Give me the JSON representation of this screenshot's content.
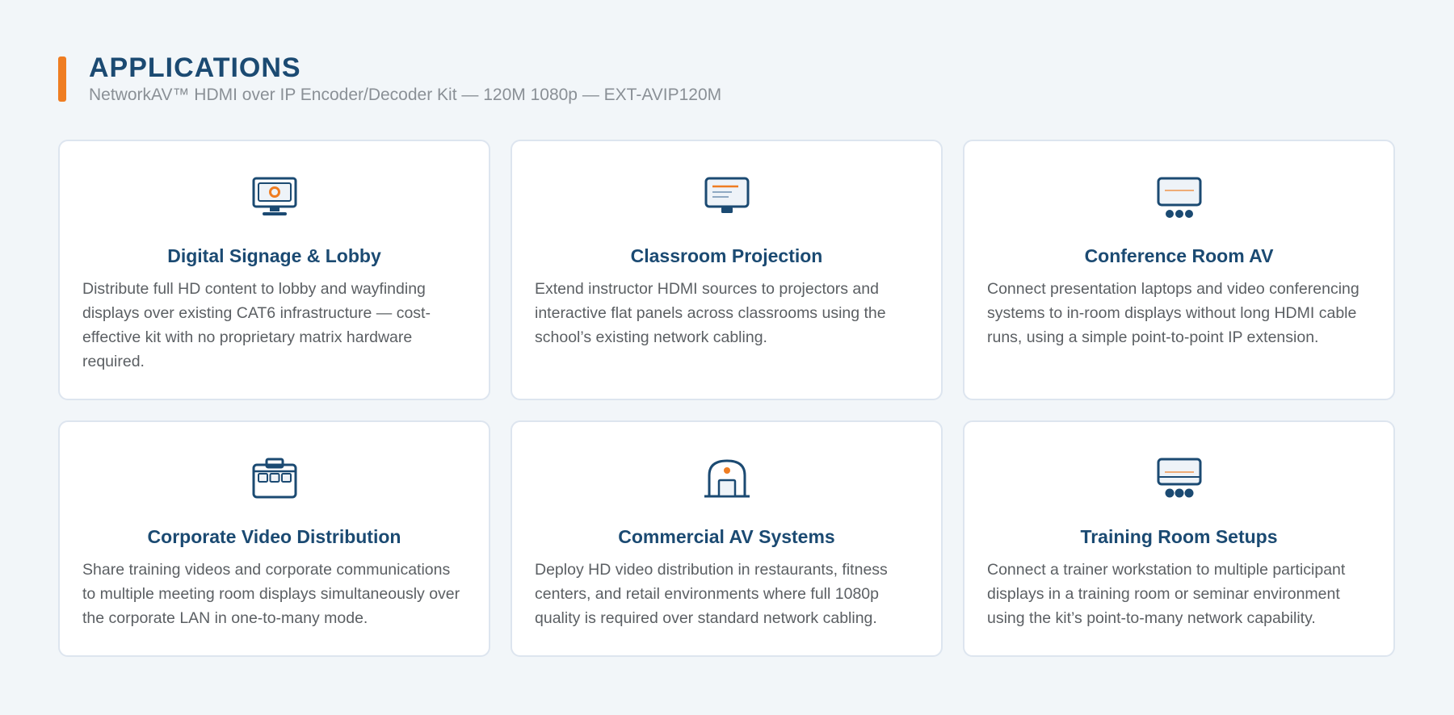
{
  "header": {
    "title": "APPLICATIONS",
    "subtitle": "NetworkAV™ HDMI over IP Encoder/Decoder Kit — 120M 1080p — EXT-AVIP120M"
  },
  "colors": {
    "accent": "#ef7d22",
    "primary": "#1b4a72",
    "background": "#f2f6f9",
    "card_border": "#dde5ef",
    "body_text": "#5b5f63",
    "subtitle_text": "#8a9096"
  },
  "cards": [
    {
      "icon": "monitor-icon",
      "title": "Digital Signage & Lobby",
      "description": "Distribute full HD content to lobby and wayfinding displays over existing CAT6 infrastructure — cost-effective kit with no proprietary matrix hardware required."
    },
    {
      "icon": "projector-screen-icon",
      "title": "Classroom Projection",
      "description": "Extend instructor HDMI sources to projectors and interactive flat panels across classrooms using the school’s existing network cabling."
    },
    {
      "icon": "conference-display-icon",
      "title": "Conference Room AV",
      "description": "Connect presentation laptops and video conferencing systems to in-room displays without long HDMI cable runs, using a simple point-to-point IP extension."
    },
    {
      "icon": "briefcase-icon",
      "title": "Corporate Video Distribution",
      "description": "Share training videos and corporate communications to multiple meeting room displays simultaneously over the corporate LAN in one-to-many mode."
    },
    {
      "icon": "storefront-icon",
      "title": "Commercial AV Systems",
      "description": "Deploy HD video distribution in restaurants, fitness centers, and retail environments where full 1080p quality is required over standard network cabling."
    },
    {
      "icon": "training-display-icon",
      "title": "Training Room Setups",
      "description": "Connect a trainer workstation to multiple participant displays in a training room or seminar environment using the kit’s point-to-many network capability."
    }
  ]
}
